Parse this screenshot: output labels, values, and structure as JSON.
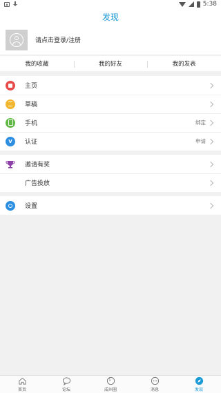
{
  "status_bar": {
    "time": "5:38"
  },
  "title": "发现",
  "profile": {
    "login_text": "请点击登录/注册"
  },
  "quick_tabs": [
    {
      "label": "我的收藏"
    },
    {
      "label": "我的好友"
    },
    {
      "label": "我的发表"
    }
  ],
  "menu_group_1": [
    {
      "label": "主页",
      "value": "",
      "icon": "home-icon",
      "color": "#e84a4a"
    },
    {
      "label": "草稿",
      "value": "",
      "icon": "draft-icon",
      "color": "#f2b52e"
    },
    {
      "label": "手机",
      "value": "绑定",
      "icon": "phone-icon",
      "color": "#62b948"
    },
    {
      "label": "认证",
      "value": "申请",
      "icon": "verify-icon",
      "icon_text": "V",
      "color": "#2e8fe0"
    }
  ],
  "menu_group_2": [
    {
      "label": "邀请有奖",
      "value": "",
      "icon": "trophy-icon",
      "color": "#8e3fa8"
    },
    {
      "label": "广告投放",
      "value": "",
      "icon": ""
    }
  ],
  "menu_group_3": [
    {
      "label": "设置",
      "value": "",
      "icon": "gear-icon",
      "color": "#2b8ee0"
    }
  ],
  "bottom_nav": [
    {
      "label": "首页",
      "icon": "home-outline-icon",
      "active": false
    },
    {
      "label": "论坛",
      "icon": "chat-bubble-icon",
      "active": false
    },
    {
      "label": "成州圈",
      "icon": "circle-icon",
      "active": false
    },
    {
      "label": "消息",
      "icon": "message-icon",
      "active": false
    },
    {
      "label": "发现",
      "icon": "compass-icon",
      "active": true
    }
  ],
  "colors": {
    "accent": "#1a9ad6",
    "background": "#f1f1f1"
  }
}
